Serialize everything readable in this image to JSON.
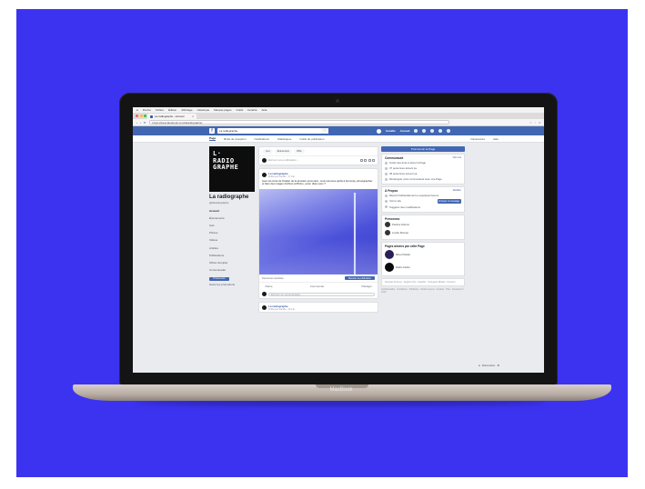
{
  "device": {
    "brand": "MacBook"
  },
  "colors": {
    "background": "#3b33f0",
    "facebook_blue": "#4267b2",
    "page_bg": "#e9ebee"
  },
  "menubar": {
    "items": [
      "Firefox",
      "Fichier",
      "Édition",
      "Affichage",
      "Historique",
      "Marque-pages",
      "Outils",
      "Fenêtre",
      "Aide"
    ],
    "right": [
      "100 %",
      "Mer. 13:45"
    ]
  },
  "browser": {
    "tab_title": "La radiographe - Accueil",
    "address": "https://www.facebook.com/laradiographe/"
  },
  "facebook": {
    "search_value": "La radiographe",
    "user": "Camille",
    "home": "Accueil",
    "page_tabs": [
      "Page",
      "Boîte de réception",
      "Notifications",
      "Statistiques",
      "Outils de publication"
    ],
    "page_tabs_right": [
      "Paramètres",
      "Aide"
    ]
  },
  "left": {
    "cover_text": [
      "L·",
      "RADIO",
      "GRAPHE"
    ],
    "page_name": "La radiographe",
    "username": "@laradiographe",
    "nav": [
      "Accueil",
      "Événements",
      "Avis",
      "Photos",
      "Vidéos",
      "Articles",
      "Publications",
      "Offres d’emploi",
      "Communauté"
    ],
    "promote": "Promouvoir",
    "manage": "Gérer les promotions"
  },
  "center": {
    "pills": [
      "Live",
      "Événement",
      "Offre"
    ],
    "composer_placeholder": "Écrivez une publication…",
    "post": {
      "author": "La radiographe",
      "meta": "Publié par Camille · 17 mai ·",
      "text": "Avec les Amis de l'Atelier de la dernière promotion, nous sommes partis à Annonay, photographier et faire des images d'arbres à Rhône, qu'en dites-vous ?"
    },
    "boost": {
      "label": "Personnes touchées",
      "button": "Booster la publication"
    },
    "actions": [
      "J'aime",
      "Commenter",
      "Partager"
    ],
    "comment_placeholder": "Écrivez un commentaire…",
    "post2": {
      "author": "La radiographe",
      "meta": "Publié par Camille · 16 mai ·"
    }
  },
  "right": {
    "cta": "Promouvoir la Page",
    "community": {
      "title": "Communauté",
      "see_all": "Voir tout",
      "lines": [
        "Inviter des amis à aimer la Page",
        "37 personnes aiment ça",
        "39 personnes suivent ça",
        "Développer votre communauté avec une Page"
      ]
    },
    "about": {
      "title": "À Propos",
      "edit": "Modifier",
      "lines": [
        "Répond habituellement en quelques heures",
        "Voir le site",
        "Suggérer des modifications"
      ],
      "send_button": "Envoyer un message"
    },
    "people": {
      "title": "Personnes",
      "names": [
        "Pauline Dubois",
        "Lucille Moreau"
      ]
    },
    "liked_pages": {
      "title": "Pages aimées par cette Page",
      "names": [
        "Mixed Media",
        "Radio Atelier"
      ]
    },
    "languages": "Français (France) · English (US) · Español · Português (Brasil) · Deutsch",
    "footer": "Confidentialité · Conditions · Publicités · Choisir sa pub · Cookies · Plus · Facebook © 2019"
  },
  "chat": {
    "label": "Discussion"
  }
}
